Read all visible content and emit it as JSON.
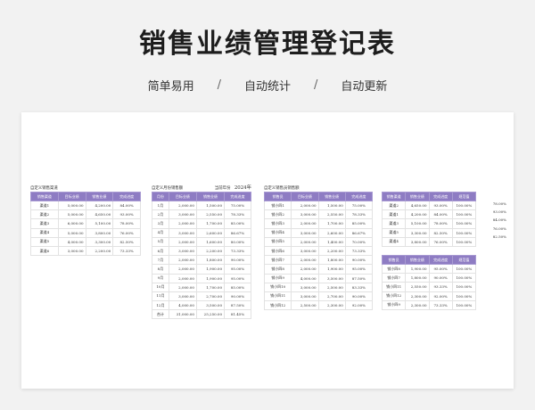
{
  "page": {
    "title": "销售业绩管理登记表",
    "subtitle": [
      "简单易用",
      "自动统计",
      "自动更新"
    ],
    "separator": "/"
  },
  "tables": {
    "channel": {
      "caption": "自定义销售渠道",
      "headers": [
        "销售渠道",
        "目标业绩",
        "销售业绩",
        "完成进度"
      ],
      "rows": [
        [
          "渠道1",
          "5,000.00",
          "4,200.00",
          "84.00%"
        ],
        [
          "渠道2",
          "5,000.00",
          "4,650.00",
          "93.00%"
        ],
        [
          "渠道3",
          "6,000.00",
          "5,100.00",
          "78.00%"
        ],
        [
          "渠道4",
          "5,000.00",
          "3,800.00",
          "76.00%"
        ],
        [
          "渠道5",
          "4,000.00",
          "3,300.00",
          "82.50%"
        ],
        [
          "渠道6",
          "3,000.00",
          "2,200.00",
          "73.33%"
        ]
      ]
    },
    "monthly": {
      "caption": "自定义月份销售额",
      "year_label": "当前年份",
      "year_value": "2024年",
      "headers": [
        "月份",
        "目标业绩",
        "销售业绩",
        "完成进度"
      ],
      "rows": [
        [
          "1月",
          "2,000.00",
          "1,500.00",
          "75.00%"
        ],
        [
          "2月",
          "3,000.00",
          "2,550.00",
          "78.33%"
        ],
        [
          "3月",
          "2,000.00",
          "1,700.00",
          "85.00%"
        ],
        [
          "4月",
          "3,000.00",
          "2,600.00",
          "86.67%"
        ],
        [
          "5月",
          "2,000.00",
          "1,600.00",
          "80.00%"
        ],
        [
          "6月",
          "3,000.00",
          "2,200.00",
          "73.33%"
        ],
        [
          "7月",
          "2,000.00",
          "1,800.00",
          "90.00%"
        ],
        [
          "8月",
          "2,000.00",
          "1,900.00",
          "95.00%"
        ],
        [
          "9月",
          "2,000.00",
          "1,900.00",
          "95.00%"
        ],
        [
          "10月",
          "2,000.00",
          "1,700.00",
          "85.00%"
        ],
        [
          "11月",
          "3,000.00",
          "2,700.00",
          "90.00%"
        ],
        [
          "12月",
          "4,000.00",
          "3,500.00",
          "87.50%"
        ],
        [
          "合计",
          "31,000.00",
          "25,250.00",
          "81.45%"
        ]
      ]
    },
    "seller": {
      "caption": "自定义销售员销售额",
      "headers": [
        "销售员",
        "目标业绩",
        "销售业绩",
        "完成进度"
      ],
      "rows": [
        [
          "销小四1",
          "2,000.00",
          "1,500.00",
          "75.00%"
        ],
        [
          "销小四2",
          "3,000.00",
          "2,550.00",
          "78.33%"
        ],
        [
          "销小四3",
          "2,000.00",
          "1,700.00",
          "85.00%"
        ],
        [
          "销小四4",
          "3,000.00",
          "2,600.00",
          "86.67%"
        ],
        [
          "销小四5",
          "2,000.00",
          "1,400.00",
          "70.00%"
        ],
        [
          "销小四6",
          "3,000.00",
          "2,200.00",
          "73.33%"
        ],
        [
          "销小四7",
          "2,000.00",
          "1,800.00",
          "90.00%"
        ],
        [
          "销小四8",
          "2,000.00",
          "1,900.00",
          "95.00%"
        ],
        [
          "销小四9",
          "4,000.00",
          "3,500.00",
          "87.50%"
        ],
        [
          "销小四10",
          "3,000.00",
          "2,500.00",
          "83.33%"
        ],
        [
          "销小四11",
          "3,000.00",
          "2,700.00",
          "90.00%"
        ],
        [
          "销小四12",
          "2,500.00",
          "2,300.00",
          "92.00%"
        ]
      ]
    },
    "channel_rank": {
      "headers": [
        "销售渠道",
        "销售业绩",
        "完成进度",
        "规范值"
      ],
      "rows": [
        [
          "渠道2",
          "4,650.00",
          "93.00%",
          "100.00%"
        ],
        [
          "渠道1",
          "4,200.00",
          "84.00%",
          "100.00%"
        ],
        [
          "渠道3",
          "5,100.00",
          "78.00%",
          "100.00%"
        ],
        [
          "渠道5",
          "3,300.00",
          "82.50%",
          "100.00%"
        ],
        [
          "渠道4",
          "3,800.00",
          "76.00%",
          "100.00%"
        ]
      ],
      "extra_col": [
        "78.00%",
        "93.00%",
        "84.00%",
        "76.00%",
        "82.50%"
      ]
    },
    "seller_rank": {
      "headers": [
        "销售员",
        "销售业绩",
        "完成进度",
        "规范值"
      ],
      "rows": [
        [
          "销小四8",
          "1,900.00",
          "95.00%",
          "100.00%"
        ],
        [
          "销小四7",
          "1,800.00",
          "90.00%",
          "100.00%"
        ],
        [
          "销小四11",
          "2,550.00",
          "93.33%",
          "100.00%"
        ],
        [
          "销小四12",
          "2,300.00",
          "92.00%",
          "100.00%"
        ],
        [
          "销小四9",
          "2,300.00",
          "73.33%",
          "100.00%"
        ]
      ]
    }
  }
}
